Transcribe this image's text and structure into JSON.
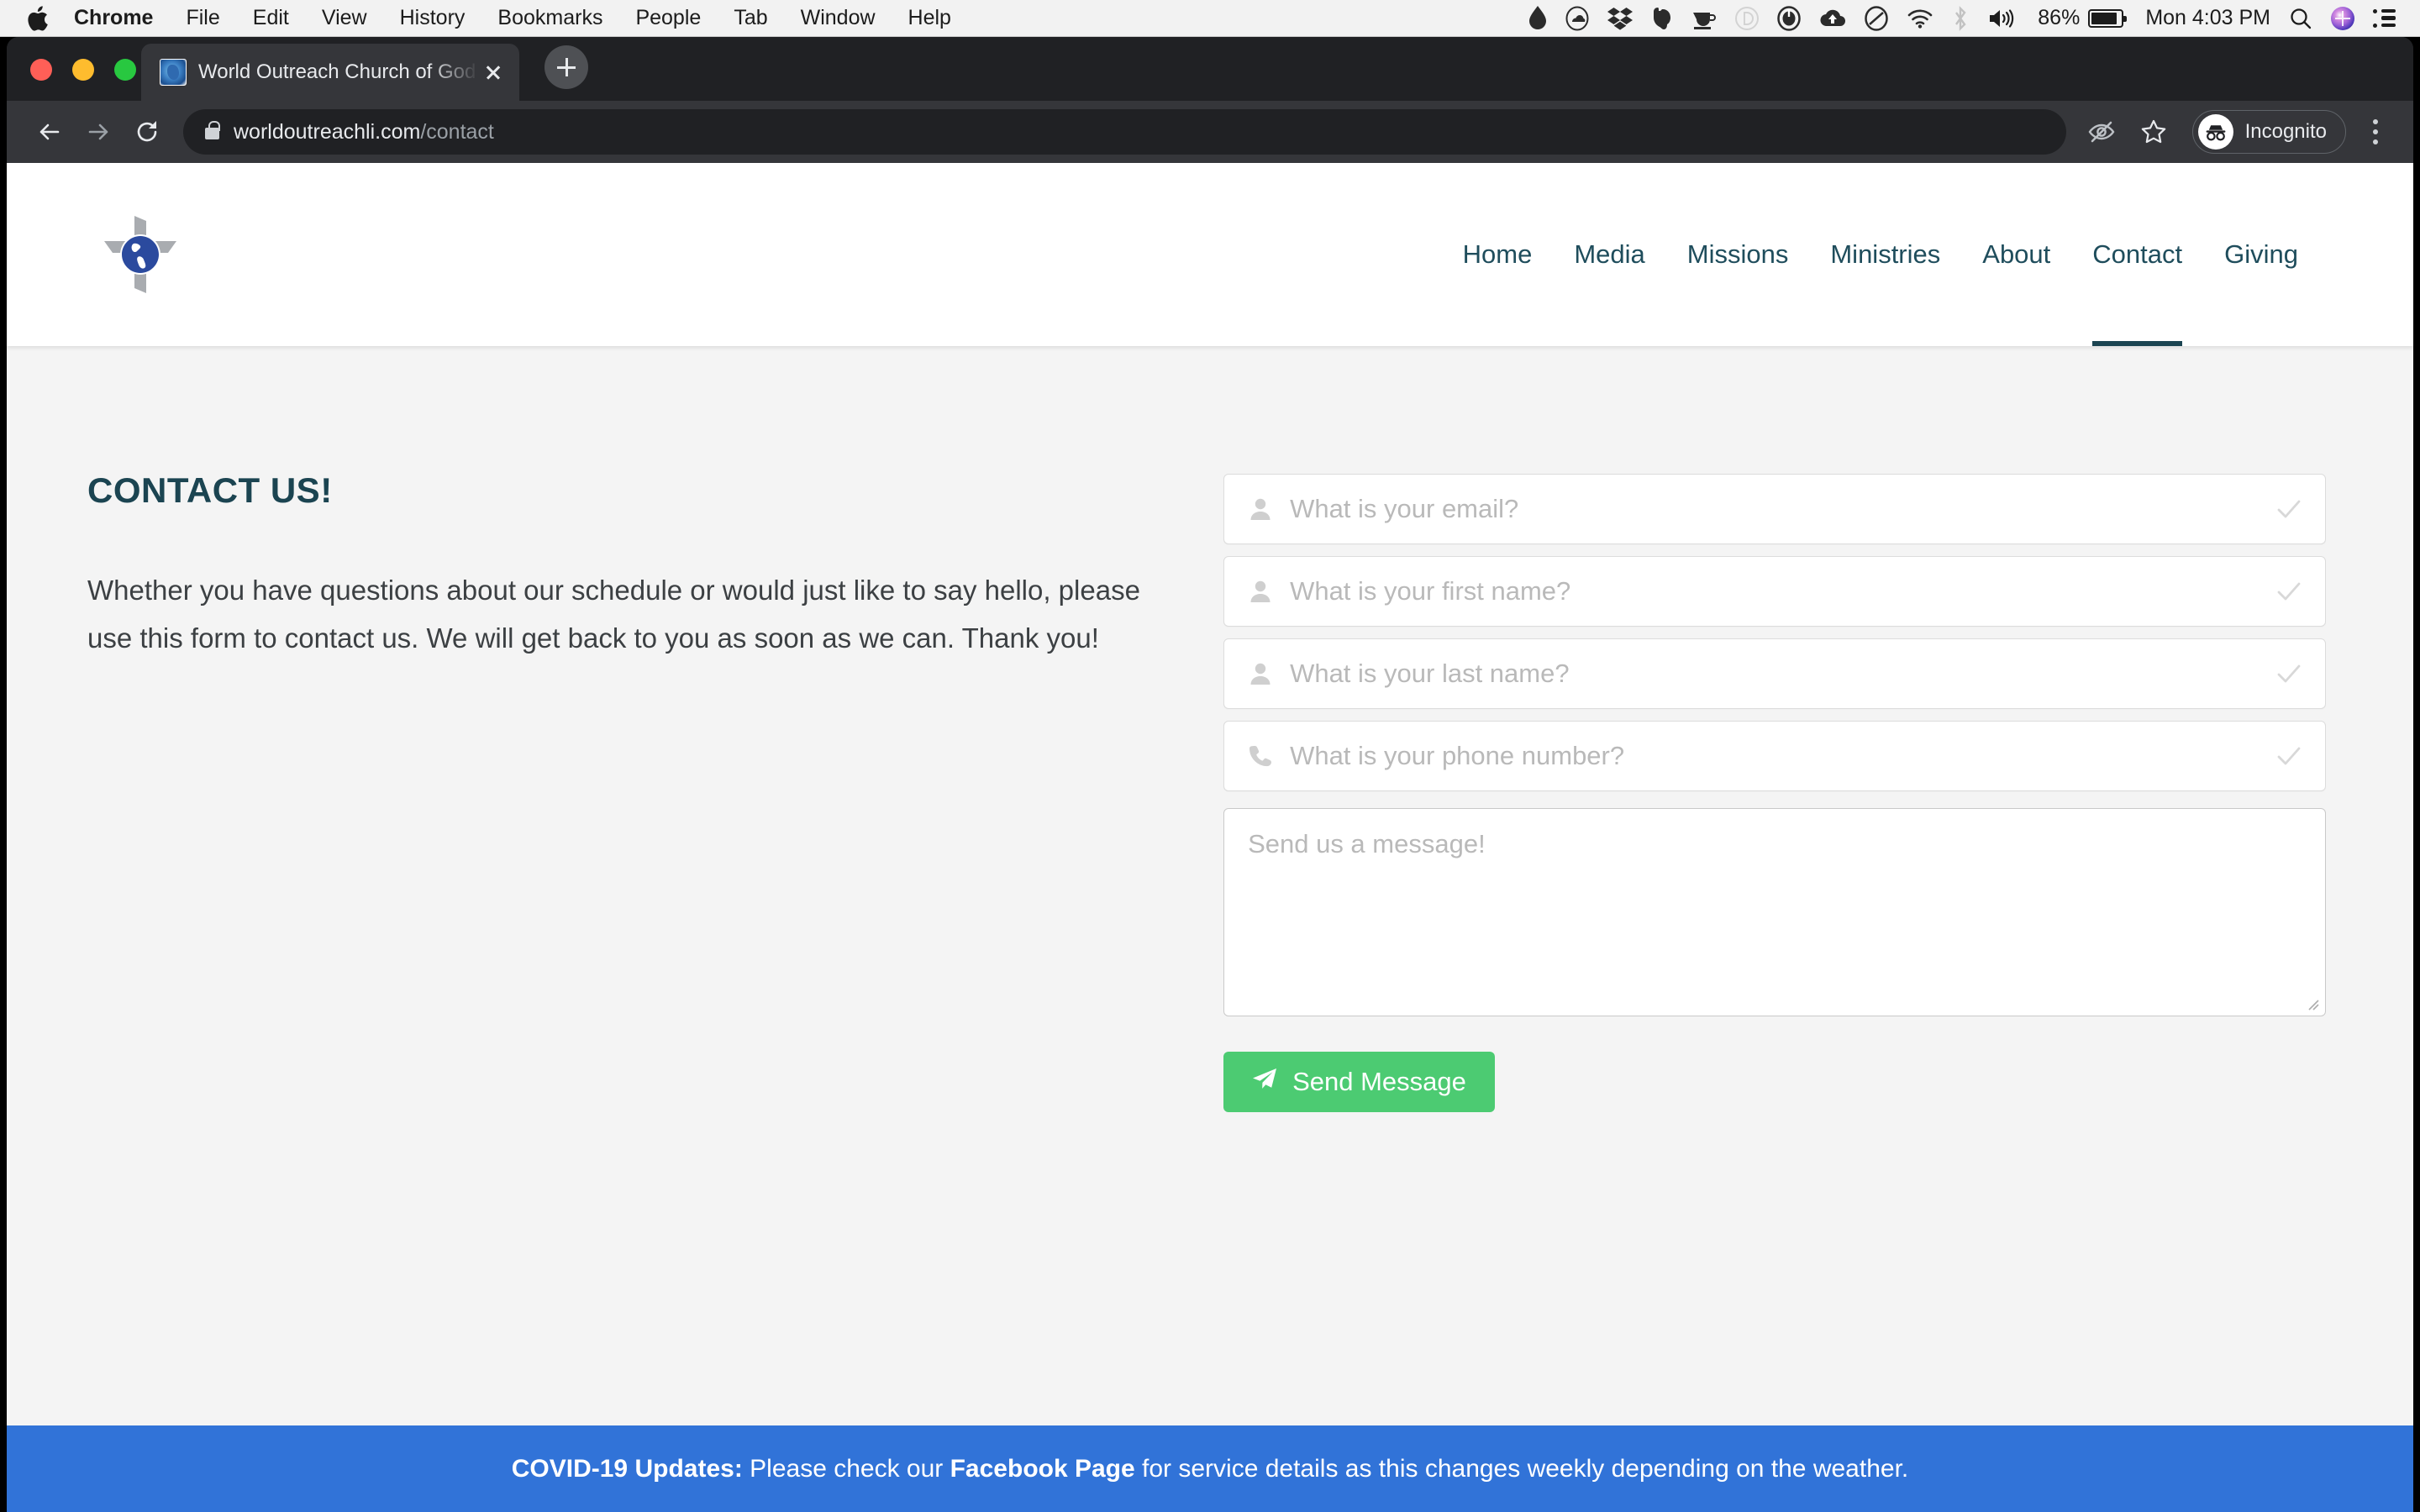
{
  "menubar": {
    "apple_icon": "apple-logo",
    "items": [
      {
        "label": "Chrome",
        "bold": true
      },
      {
        "label": "File",
        "bold": false
      },
      {
        "label": "Edit",
        "bold": false
      },
      {
        "label": "View",
        "bold": false
      },
      {
        "label": "History",
        "bold": false
      },
      {
        "label": "Bookmarks",
        "bold": false
      },
      {
        "label": "People",
        "bold": false
      },
      {
        "label": "Tab",
        "bold": false
      },
      {
        "label": "Window",
        "bold": false
      },
      {
        "label": "Help",
        "bold": false
      }
    ],
    "status_icons": [
      "teardrop-icon",
      "cloud-oval-icon",
      "dropbox-icon",
      "evernote-elephant-icon",
      "coffee-cup-icon",
      "d-circle-icon",
      "power-circle-icon",
      "cloud-upload-icon",
      "oval-slash-icon",
      "wifi-icon",
      "bluetooth-icon",
      "volume-icon"
    ],
    "battery_percent": "86%",
    "clock": "Mon 4:03 PM",
    "right_icons": [
      "search-icon",
      "siri-icon",
      "control-center-icon"
    ]
  },
  "browser": {
    "tab": {
      "title": "World Outreach Church of God",
      "favicon": "globe-favicon",
      "close_icon": "close-icon"
    },
    "new_tab_icon": "plus-icon",
    "toolbar": {
      "back_icon": "back-arrow-icon",
      "forward_icon": "forward-arrow-icon",
      "reload_icon": "reload-icon",
      "lock_icon": "lock-icon",
      "url_domain": "worldoutreachli.com",
      "url_path": "/contact",
      "url_full": "worldoutreachli.com/contact",
      "eye_off_icon": "eye-off-icon",
      "bookmark_icon": "star-icon",
      "incognito_label": "Incognito",
      "incognito_icon": "incognito-icon",
      "menu_icon": "kebab-menu-icon"
    },
    "window_controls": [
      "close",
      "minimize",
      "maximize"
    ]
  },
  "site": {
    "logo_name": "church-cross-globe-logo",
    "nav": [
      {
        "label": "Home",
        "active": false
      },
      {
        "label": "Media",
        "active": false
      },
      {
        "label": "Missions",
        "active": false
      },
      {
        "label": "Ministries",
        "active": false
      },
      {
        "label": "About",
        "active": false
      },
      {
        "label": "Contact",
        "active": true
      },
      {
        "label": "Giving",
        "active": false
      }
    ],
    "heading": "CONTACT US!",
    "intro": "Whether you have questions about our schedule or would just like to say hello, please use this form to contact us. We will get back to you as soon as we can. Thank you!",
    "form": {
      "email": {
        "placeholder": "What is your email?",
        "value": "",
        "icon": "person-icon",
        "check_icon": "check-icon"
      },
      "first_name": {
        "placeholder": "What is your first name?",
        "value": "",
        "icon": "person-icon",
        "check_icon": "check-icon"
      },
      "last_name": {
        "placeholder": "What is your last name?",
        "value": "",
        "icon": "person-icon",
        "check_icon": "check-icon"
      },
      "phone": {
        "placeholder": "What is your phone number?",
        "value": "",
        "icon": "phone-icon",
        "check_icon": "check-icon"
      },
      "message": {
        "placeholder": "Send us a message!",
        "value": ""
      },
      "submit_label": "Send Message",
      "submit_icon": "paper-plane-icon"
    },
    "banner": {
      "bold_prefix": "COVID-19 Updates:",
      "text_1": " Please check our ",
      "link": "Facebook Page",
      "text_2": " for service details as this changes weekly depending on the weather."
    },
    "colors": {
      "accent_teal": "#1b4451",
      "send_green": "#4ccb72",
      "banner_blue": "#3173d8",
      "page_bg": "#f4f4f4"
    }
  }
}
